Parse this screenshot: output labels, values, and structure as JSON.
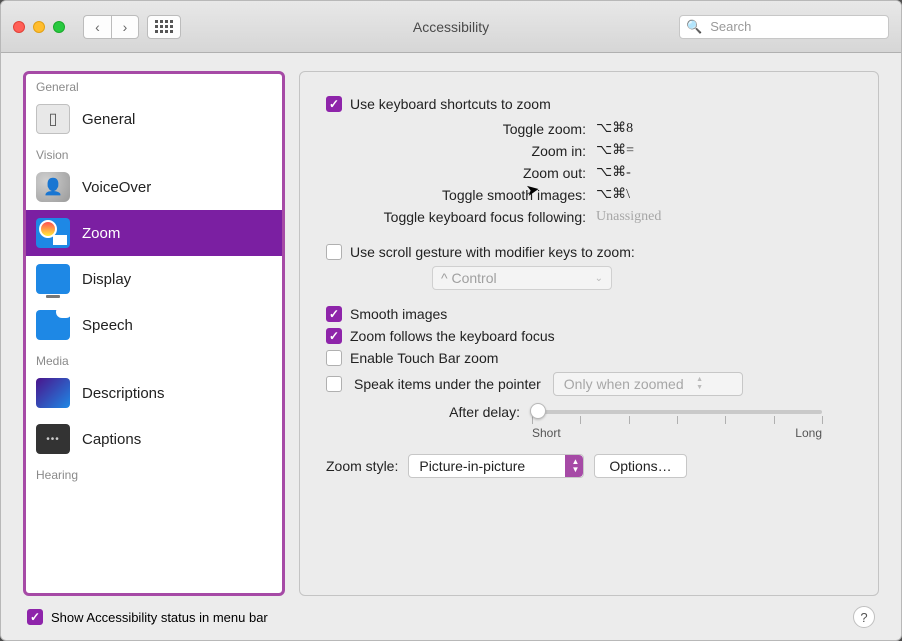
{
  "window": {
    "title": "Accessibility"
  },
  "search": {
    "placeholder": "Search"
  },
  "sidebar": {
    "sections": [
      {
        "label": "General",
        "items": [
          {
            "label": "General",
            "icon": "general"
          }
        ]
      },
      {
        "label": "Vision",
        "items": [
          {
            "label": "VoiceOver",
            "icon": "voiceover"
          },
          {
            "label": "Zoom",
            "icon": "zoom",
            "selected": true
          },
          {
            "label": "Display",
            "icon": "display"
          },
          {
            "label": "Speech",
            "icon": "speech"
          }
        ]
      },
      {
        "label": "Media",
        "items": [
          {
            "label": "Descriptions",
            "icon": "desc"
          },
          {
            "label": "Captions",
            "icon": "captions"
          }
        ]
      },
      {
        "label": "Hearing",
        "items": []
      }
    ]
  },
  "main": {
    "useKeyboardShortcuts": {
      "label": "Use keyboard shortcuts to zoom",
      "checked": true
    },
    "shortcuts": {
      "toggleZoom": {
        "label": "Toggle zoom:",
        "value": "⌥⌘8"
      },
      "zoomIn": {
        "label": "Zoom in:",
        "value": "⌥⌘="
      },
      "zoomOut": {
        "label": "Zoom out:",
        "value": "⌥⌘-"
      },
      "toggleSmooth": {
        "label": "Toggle smooth images:",
        "value": "⌥⌘\\"
      },
      "toggleFocus": {
        "label": "Toggle keyboard focus following:",
        "value": "Unassigned"
      }
    },
    "useScrollGesture": {
      "label": "Use scroll gesture with modifier keys to zoom:",
      "checked": false
    },
    "scrollModifier": {
      "value": "^ Control"
    },
    "smoothImages": {
      "label": "Smooth images",
      "checked": true
    },
    "zoomFollowsFocus": {
      "label": "Zoom follows the keyboard focus",
      "checked": true
    },
    "enableTouchBar": {
      "label": "Enable Touch Bar zoom",
      "checked": false
    },
    "speakItems": {
      "label": "Speak items under the pointer",
      "checked": false
    },
    "speakMode": {
      "value": "Only when zoomed"
    },
    "afterDelay": {
      "label": "After delay:",
      "min": "Short",
      "max": "Long"
    },
    "zoomStyle": {
      "label": "Zoom style:",
      "value": "Picture-in-picture",
      "optionsLabel": "Options…"
    }
  },
  "footer": {
    "showStatus": {
      "label": "Show Accessibility status in menu bar",
      "checked": true
    }
  }
}
